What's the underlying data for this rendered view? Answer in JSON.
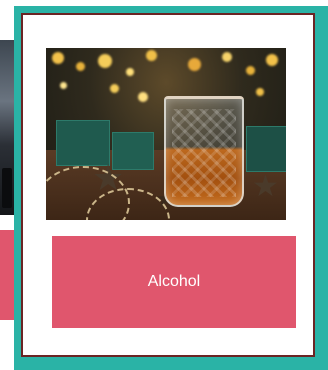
{
  "carousel": {
    "selected_card": {
      "label": "Alcohol",
      "image_icon": "whiskey-glass-photo"
    }
  },
  "colors": {
    "selection_border": "#2ab3a6",
    "card_border": "#6b2424",
    "label_background": "#e0566d",
    "label_text": "#ffffff"
  }
}
